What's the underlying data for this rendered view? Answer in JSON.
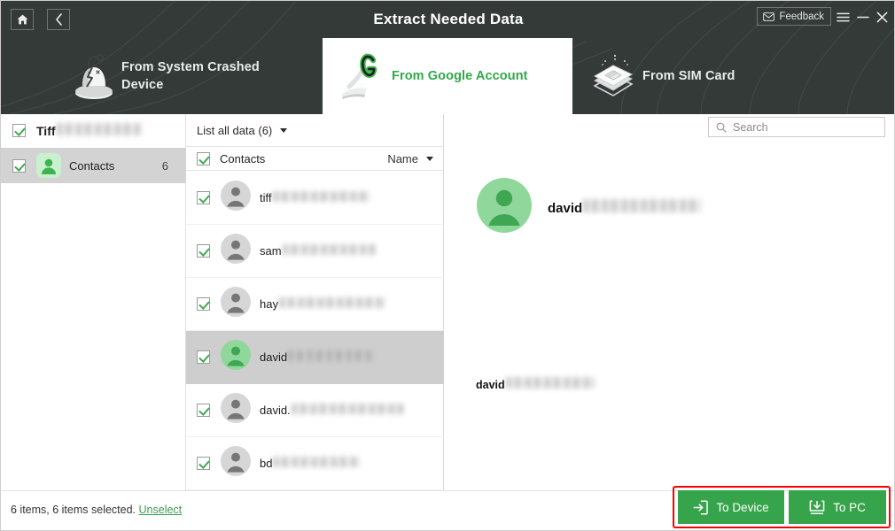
{
  "window": {
    "title": "Extract Needed Data",
    "home_icon": "home-icon",
    "back_icon": "chevron-left-icon",
    "feedback_label": "Feedback",
    "feedback_icon": "envelope-icon",
    "menu_icon": "hamburger-menu-icon",
    "minimize_icon": "minimize-icon",
    "close_icon": "close-icon",
    "accent_green": "#35a44b",
    "header_bg": "#343a38",
    "highlight_red": "#ff0000"
  },
  "tabs": [
    {
      "id": "crashed",
      "label": "From System Crashed Device",
      "icon": "broken-android-robot-icon",
      "active": false
    },
    {
      "id": "google",
      "label": "From Google Account",
      "icon": "google-account-icon",
      "active": true
    },
    {
      "id": "sim",
      "label": "From SIM Card",
      "icon": "sim-card-icon",
      "active": false
    }
  ],
  "sidebar": {
    "account": {
      "name_visible": "Tiff",
      "name_redacted": true,
      "checked": true
    },
    "items": [
      {
        "label": "Contacts",
        "count": "6",
        "icon": "contact-person-icon",
        "checked": true,
        "selected": true
      }
    ]
  },
  "list_panel": {
    "filter_label": "List all data (6)",
    "filter_caret_icon": "chevron-down-icon",
    "header_title": "Contacts",
    "header_checked": true,
    "sort_label": "Name",
    "sort_caret_icon": "chevron-down-icon",
    "rows": [
      {
        "name_visible": "tiff",
        "name_redacted": true,
        "redact_width": 110,
        "checked": true,
        "selected": false,
        "avatar": "gray"
      },
      {
        "name_visible": "sam",
        "name_redacted": true,
        "redact_width": 105,
        "checked": true,
        "selected": false,
        "avatar": "gray"
      },
      {
        "name_visible": "hay",
        "name_redacted": true,
        "redact_width": 120,
        "checked": true,
        "selected": false,
        "avatar": "gray"
      },
      {
        "name_visible": "david",
        "name_redacted": true,
        "redact_width": 98,
        "checked": true,
        "selected": true,
        "avatar": "green"
      },
      {
        "name_visible": "david.",
        "name_redacted": true,
        "redact_width": 126,
        "checked": true,
        "selected": false,
        "avatar": "gray"
      },
      {
        "name_visible": "bd",
        "name_redacted": true,
        "redact_width": 98,
        "checked": true,
        "selected": false,
        "avatar": "gray"
      }
    ]
  },
  "search": {
    "placeholder": "Search",
    "value": "",
    "icon": "search-icon"
  },
  "detail": {
    "avatar": "green-contact-avatar",
    "name_visible": "david",
    "name_redacted": true,
    "sub_visible": "david",
    "sub_redacted": true
  },
  "footer": {
    "status_text": "6 items, 6 items selected.",
    "unselect_label": "Unselect",
    "buttons": [
      {
        "id": "to-device",
        "label": "To Device",
        "icon": "export-to-device-icon"
      },
      {
        "id": "to-pc",
        "label": "To PC",
        "icon": "download-to-pc-icon"
      }
    ]
  }
}
